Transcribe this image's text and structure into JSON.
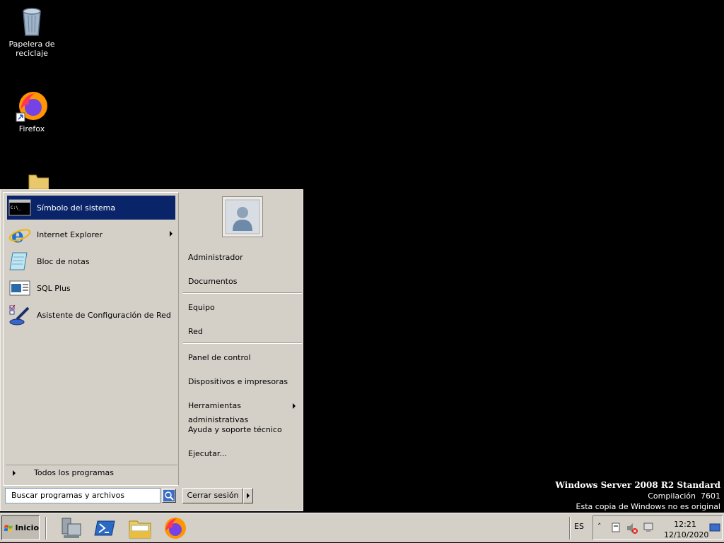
{
  "desktop": {
    "icons": [
      {
        "label": "Papelera de reciclaje",
        "icon": "recycle-bin-icon"
      },
      {
        "label": "Firefox",
        "icon": "firefox-icon"
      },
      {
        "label": "",
        "icon": "folder-icon"
      }
    ]
  },
  "start_menu": {
    "programs": [
      {
        "label": "Símbolo del sistema",
        "icon": "command-prompt-icon",
        "selected": true
      },
      {
        "label": "Internet Explorer",
        "icon": "internet-explorer-icon",
        "submenu": true
      },
      {
        "label": "Bloc de notas",
        "icon": "notepad-icon"
      },
      {
        "label": "SQL Plus",
        "icon": "sql-plus-icon"
      },
      {
        "label": "Asistente de Configuración de Red",
        "icon": "network-wizard-icon"
      }
    ],
    "all_programs": "Todos los programas",
    "search_placeholder": "Buscar programas y archivos",
    "right": {
      "user": "Administrador",
      "documents": "Documentos",
      "computer": "Equipo",
      "network": "Red",
      "control_panel": "Panel de control",
      "devices": "Dispositivos e impresoras",
      "admin_tools": "Herramientas administrativas",
      "help": "Ayuda y soporte técnico",
      "run": "Ejecutar..."
    },
    "logoff": "Cerrar sesión"
  },
  "taskbar": {
    "start_label": "Inicio",
    "pinned": [
      "server-manager-icon",
      "powershell-icon",
      "explorer-icon",
      "firefox-icon"
    ],
    "language": "ES",
    "time": "12:21",
    "date": "12/10/2020"
  },
  "watermark": {
    "line1": "Windows Server 2008 R2 Standard",
    "line2": "Compilación  7601",
    "line3": "Esta copia de Windows no es original"
  },
  "colors": {
    "selection": "#0a246a",
    "menu_bg": "#d4d0c8",
    "desktop": "#000000"
  }
}
